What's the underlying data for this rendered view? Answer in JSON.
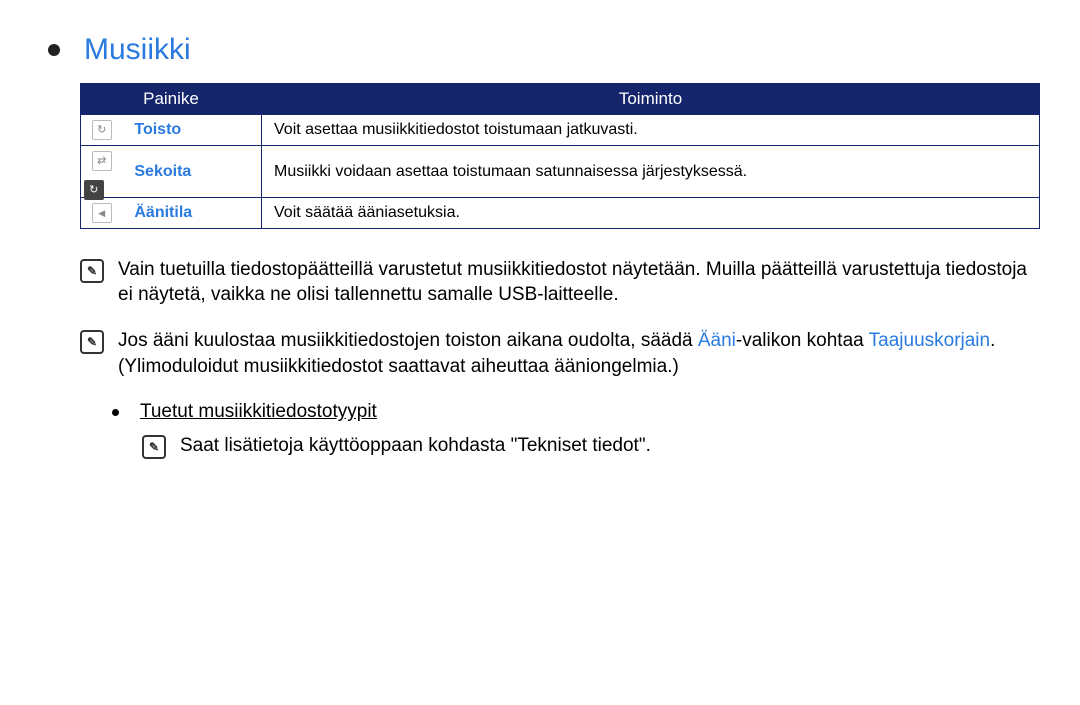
{
  "heading": "Musiikki",
  "table": {
    "headers": [
      "Painike",
      "Toiminto"
    ],
    "rows": [
      {
        "label": "Toisto",
        "desc": "Voit asettaa musiikkitiedostot toistumaan jatkuvasti."
      },
      {
        "label": "Sekoita",
        "desc": "Musiikki voidaan asettaa toistumaan satunnaisessa järjestyksessä."
      },
      {
        "label": "Äänitila",
        "desc": "Voit säätää ääniasetuksia."
      }
    ]
  },
  "note1": "Vain tuetuilla tiedostopäätteillä varustetut musiikkitiedostot näytetään. Muilla päätteillä varustettuja tiedostoja ei näytetä, vaikka ne olisi tallennettu samalle USB-laitteelle.",
  "note2a": "Jos ääni kuulostaa musiikkitiedostojen toiston aikana oudolta, säädä ",
  "note2_link1": "Ääni",
  "note2b": "-valikon kohtaa ",
  "note2_link2": "Taajuuskorjain",
  "note2c": ". (Ylimoduloidut musiikkitiedostot saattavat aiheuttaa ääniongelmia.)",
  "subheading": "Tuetut musiikkitiedostotyypit",
  "subnote": "Saat lisätietoja käyttöoppaan kohdasta \"Tekniset tiedot\"."
}
